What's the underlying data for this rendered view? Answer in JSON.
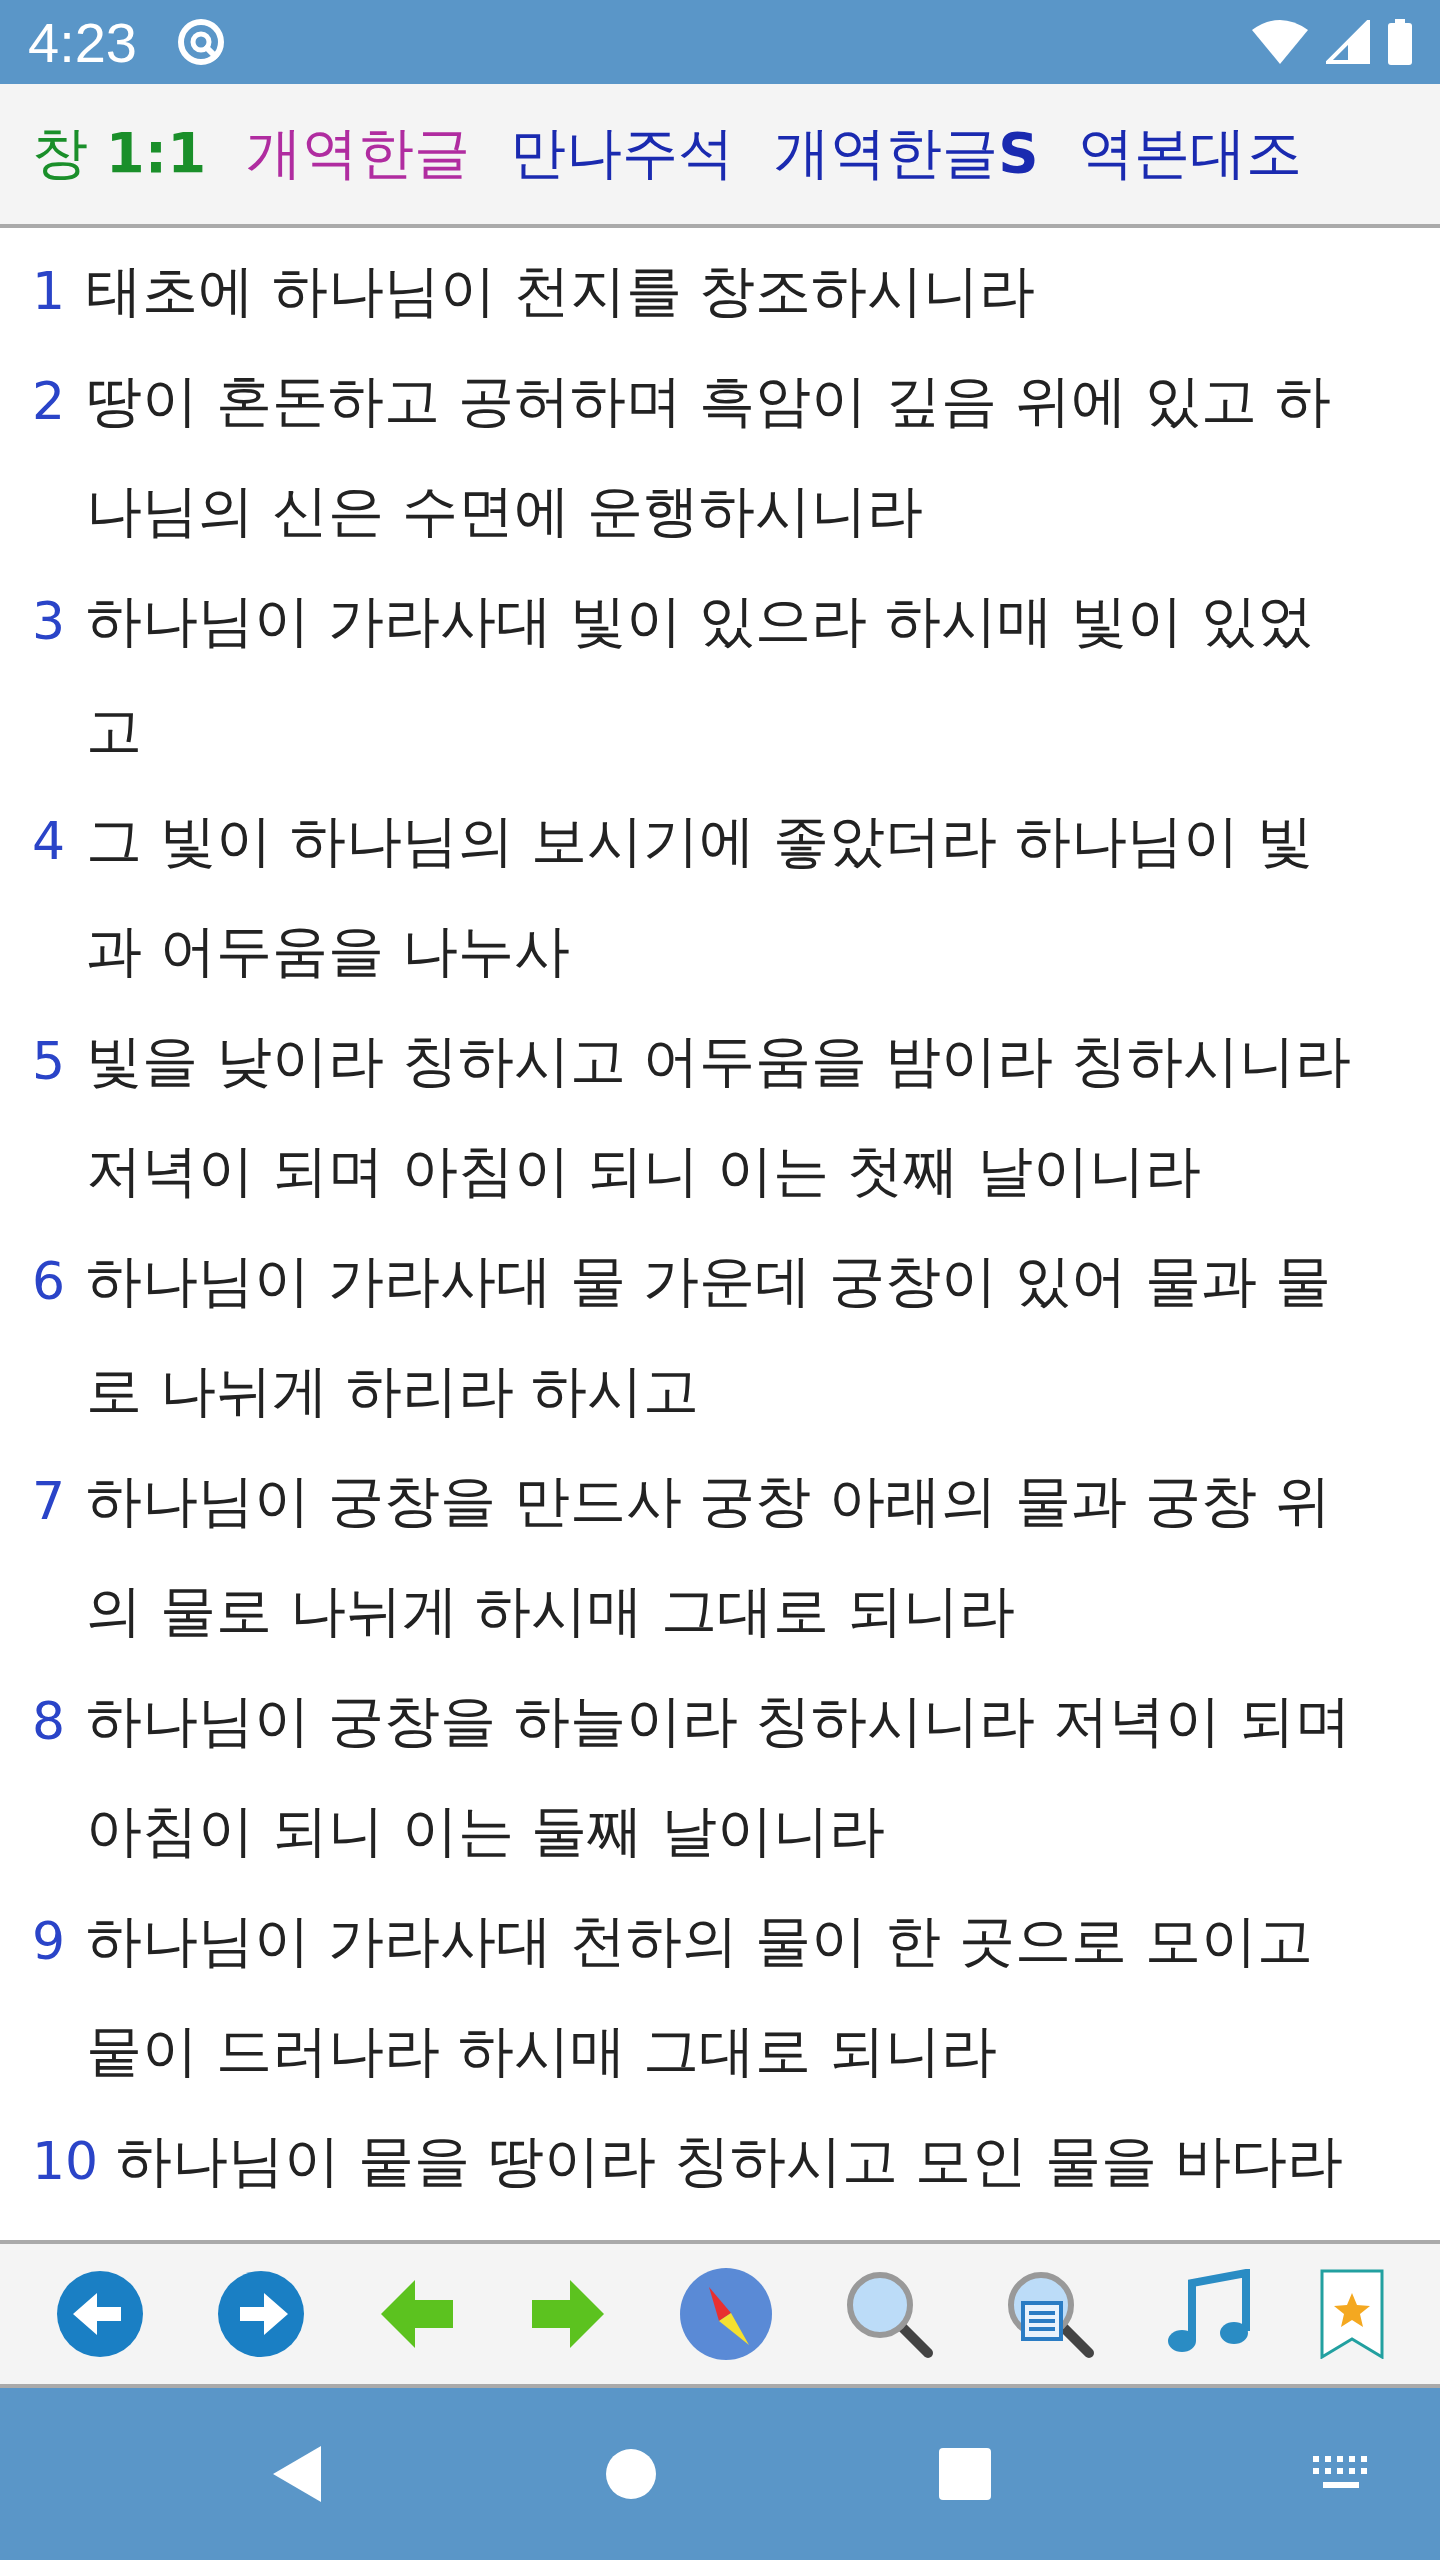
{
  "status_bar": {
    "time": "4:23"
  },
  "header": {
    "reference": "창 **1:1**",
    "tabs": [
      {
        "label": "개역한글",
        "selected": true
      },
      {
        "label": "만나주석",
        "selected": false
      },
      {
        "label": "개역한글**S**",
        "selected": false
      },
      {
        "label": "역본대조",
        "selected": false
      }
    ]
  },
  "verses": [
    {
      "number": "1",
      "lines": [
        "태초에 하나님이 천지를 창조하시니라"
      ]
    },
    {
      "number": "2",
      "lines": [
        "땅이 혼돈하고 공허하며 흑암이 깊음 위에 있고 하",
        "나님의 신은 수면에 운행하시니라"
      ]
    },
    {
      "number": "3",
      "lines": [
        "하나님이 가라사대 빛이 있으라 하시매 빛이 있었",
        "고"
      ]
    },
    {
      "number": "4",
      "lines": [
        "그 빛이 하나님의 보시기에 좋았더라 하나님이 빛",
        "과 어두움을 나누사"
      ]
    },
    {
      "number": "5",
      "lines": [
        "빛을 낮이라 칭하시고 어두움을 밤이라 칭하시니라",
        "저녁이 되며 아침이 되니 이는 첫째 날이니라"
      ]
    },
    {
      "number": "6",
      "lines": [
        "하나님이 가라사대 물 가운데 궁창이 있어 물과 물",
        "로 나뉘게 하리라 하시고"
      ]
    },
    {
      "number": "7",
      "lines": [
        "하나님이 궁창을 만드사 궁창 아래의 물과 궁창 위",
        "의 물로 나뉘게 하시매 그대로 되니라"
      ]
    },
    {
      "number": "8",
      "lines": [
        "하나님이 궁창을 하늘이라 칭하시니라 저녁이 되며",
        "아침이 되니 이는 둘째 날이니라"
      ]
    },
    {
      "number": "9",
      "lines": [
        "하나님이 가라사대 천하의 물이 한 곳으로 모이고",
        "뭍이 드러나라 하시매 그대로 되니라"
      ]
    },
    {
      "number": "10",
      "lines": [
        "하나님이 뭍을 땅이라 칭하시고 모인 물을 바다라"
      ]
    }
  ]
}
